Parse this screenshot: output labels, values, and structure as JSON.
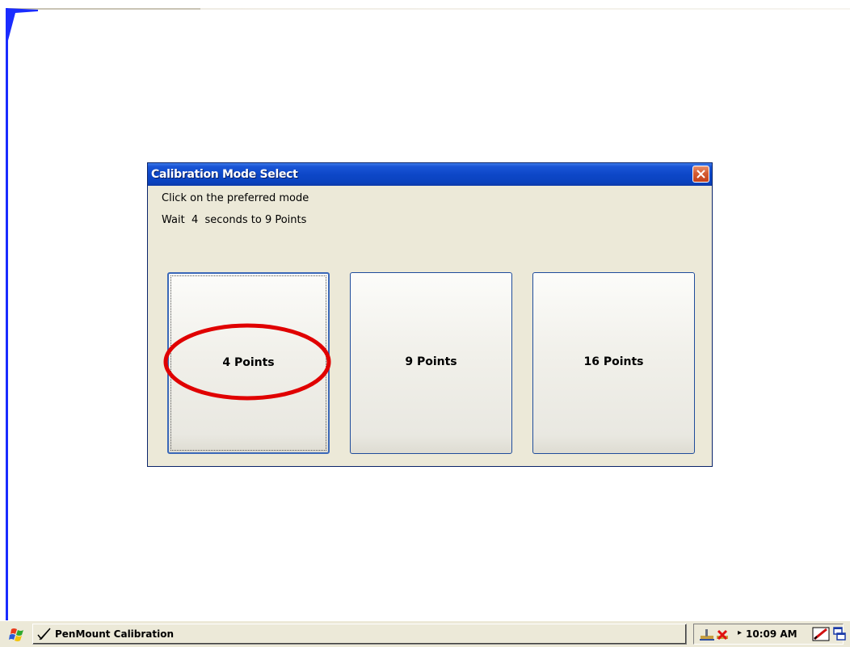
{
  "dialog": {
    "title": "Calibration Mode Select",
    "instruction": "Click on the preferred mode",
    "countdown_text": "Wait  4  seconds to 9 Points",
    "close_icon": "close-icon",
    "modes": [
      {
        "label": "4 Points",
        "focused": true,
        "highlighted": true
      },
      {
        "label": "9 Points",
        "focused": false,
        "highlighted": false
      },
      {
        "label": "16 Points",
        "focused": false,
        "highlighted": false
      }
    ]
  },
  "taskbar": {
    "start_icon": "windows-flag-icon",
    "task_icon": "pen-check-icon",
    "task_label": "PenMount Calibration",
    "tray_arrow": "▸",
    "clock": "10:09 AM"
  },
  "colors": {
    "title_bar": "#0d47c8",
    "dialog_bg": "#ece9d8",
    "highlight_ellipse": "#e00000",
    "close_button": "#d45c32"
  }
}
